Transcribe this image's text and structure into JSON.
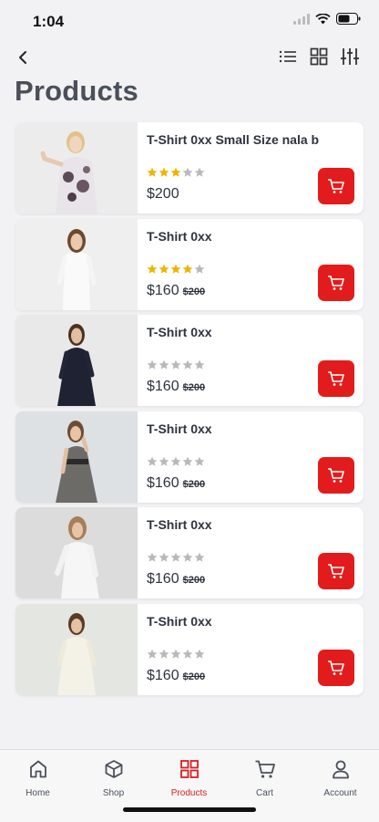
{
  "status": {
    "time": "1:04"
  },
  "page": {
    "title": "Products"
  },
  "colors": {
    "accent": "#e21c1c",
    "star_filled": "#f0b400",
    "star_empty": "#b9b9b9"
  },
  "products": [
    {
      "name": "T-Shirt 0xx Small Size nala b",
      "rating": 3,
      "price": "$200",
      "old_price": ""
    },
    {
      "name": "T-Shirt 0xx",
      "rating": 4,
      "price": "$160",
      "old_price": "$200"
    },
    {
      "name": "T-Shirt 0xx",
      "rating": 0,
      "price": "$160",
      "old_price": "$200"
    },
    {
      "name": "T-Shirt 0xx",
      "rating": 0,
      "price": "$160",
      "old_price": "$200"
    },
    {
      "name": "T-Shirt 0xx",
      "rating": 0,
      "price": "$160",
      "old_price": "$200"
    },
    {
      "name": "T-Shirt 0xx",
      "rating": 0,
      "price": "$160",
      "old_price": "$200"
    }
  ],
  "tabs": [
    {
      "label": "Home",
      "icon": "home-icon",
      "active": false
    },
    {
      "label": "Shop",
      "icon": "box-icon",
      "active": false
    },
    {
      "label": "Products",
      "icon": "grid-icon",
      "active": true
    },
    {
      "label": "Cart",
      "icon": "cart-icon",
      "active": false
    },
    {
      "label": "Account",
      "icon": "person-icon",
      "active": false
    }
  ]
}
